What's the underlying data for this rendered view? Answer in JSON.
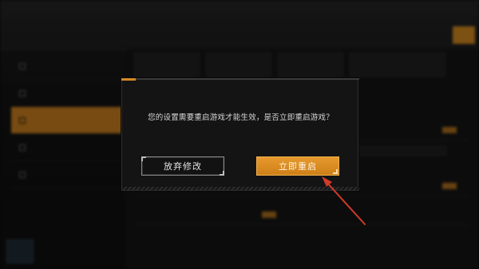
{
  "dialog": {
    "message": "您的设置需要重启游戏才能生效，是否立即重启游戏？",
    "discard_label": "放弃修改",
    "restart_label": "立即重启"
  },
  "colors": {
    "accent": "#d38b24",
    "primary_button": "#e0912a",
    "annotation_arrow": "#d23a2a"
  },
  "icons": {
    "annotation": "arrow-pointer-icon"
  }
}
